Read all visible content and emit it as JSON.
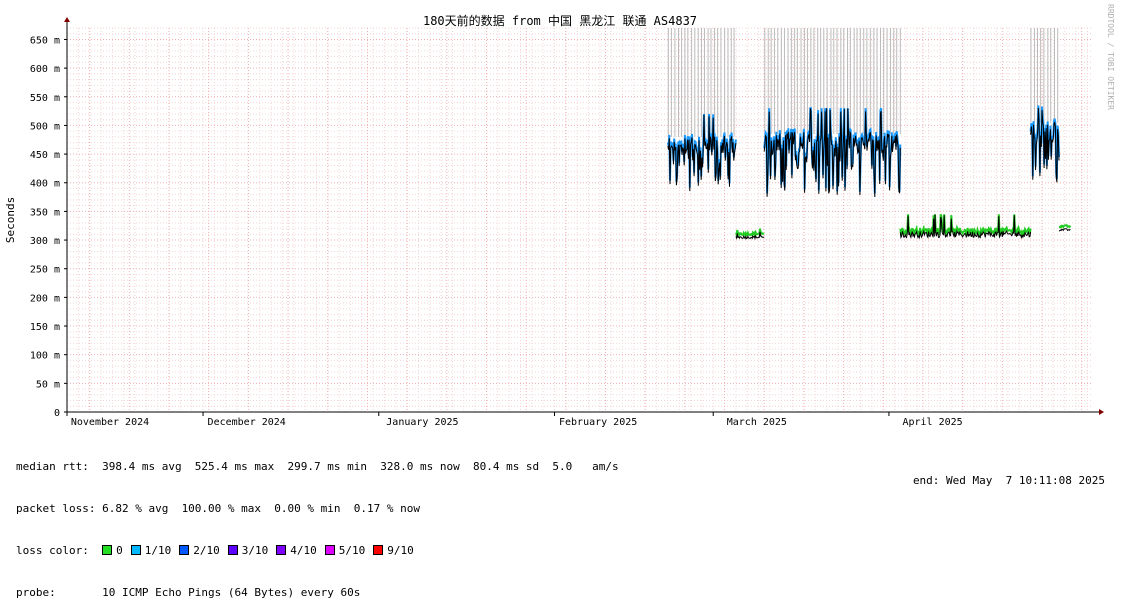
{
  "chart_data": {
    "type": "line",
    "title": "180天前的数据 from 中国 黑龙江 联通 AS4837",
    "ylabel": "Seconds",
    "xlabel": "",
    "ylim": [
      0,
      670
    ],
    "xlim": [
      "2024-11-07",
      "2025-05-07"
    ],
    "y_ticks": [
      {
        "value": 0,
        "label": "0"
      },
      {
        "value": 50,
        "label": "50 m"
      },
      {
        "value": 100,
        "label": "100 m"
      },
      {
        "value": 150,
        "label": "150 m"
      },
      {
        "value": 200,
        "label": "200 m"
      },
      {
        "value": 250,
        "label": "250 m"
      },
      {
        "value": 300,
        "label": "300 m"
      },
      {
        "value": 350,
        "label": "350 m"
      },
      {
        "value": 400,
        "label": "400 m"
      },
      {
        "value": 450,
        "label": "450 m"
      },
      {
        "value": 500,
        "label": "500 m"
      },
      {
        "value": 550,
        "label": "550 m"
      },
      {
        "value": 600,
        "label": "600 m"
      },
      {
        "value": 650,
        "label": "650 m"
      }
    ],
    "x_ticks": [
      {
        "date": "2024-11-01",
        "label": "November 2024"
      },
      {
        "date": "2024-12-01",
        "label": "December 2024"
      },
      {
        "date": "2025-01-01",
        "label": "January 2025"
      },
      {
        "date": "2025-02-01",
        "label": "February 2025"
      },
      {
        "date": "2025-03-01",
        "label": "March 2025"
      },
      {
        "date": "2025-04-01",
        "label": "April 2025"
      }
    ],
    "grid": true,
    "segments": [
      {
        "start": "2025-02-21",
        "end": "2025-03-05",
        "base": 465,
        "low": 385,
        "high": 520,
        "loss_spikes": true
      },
      {
        "start": "2025-03-05",
        "end": "2025-03-10",
        "base": 305,
        "low": 300,
        "high": 320,
        "loss_spikes": false
      },
      {
        "start": "2025-03-10",
        "end": "2025-04-03",
        "base": 470,
        "low": 375,
        "high": 530,
        "loss_spikes": true
      },
      {
        "start": "2025-04-03",
        "end": "2025-04-26",
        "base": 310,
        "low": 300,
        "high": 345,
        "loss_spikes": false
      },
      {
        "start": "2025-04-26",
        "end": "2025-05-01",
        "base": 490,
        "low": 400,
        "high": 535,
        "loss_spikes": true
      },
      {
        "start": "2025-05-01",
        "end": "2025-05-03",
        "base": 318,
        "low": 315,
        "high": 330,
        "loss_spikes": false
      }
    ],
    "colors": {
      "grid": "#f0b0b0",
      "axis": "#000000",
      "arrow": "#800000",
      "median": "#000000",
      "rtt_band": "#1a99ff",
      "loss_spike": "#bbbbbb",
      "low_loss_band": "#22cc22"
    }
  },
  "stats": {
    "median_rtt": "median rtt:  398.4 ms avg  525.4 ms max  299.7 ms min  328.0 ms now  80.4 ms sd  5.0   am/s",
    "packet_loss": "packet loss: 6.82 % avg  100.00 % max  0.00 % min  0.17 % now",
    "loss_color_label": "loss color:",
    "probe": "probe:       10 ICMP Echo Pings (64 Bytes) every 60s",
    "end": "end: Wed May  7 10:11:08 2025"
  },
  "loss_colors": [
    {
      "label": "0",
      "color": "#22dd22"
    },
    {
      "label": "1/10",
      "color": "#00b8ff"
    },
    {
      "label": "2/10",
      "color": "#0059ff"
    },
    {
      "label": "3/10",
      "color": "#5e00ff"
    },
    {
      "label": "4/10",
      "color": "#7e00ff"
    },
    {
      "label": "5/10",
      "color": "#dd00ff"
    },
    {
      "label": "9/10",
      "color": "#ff0000"
    }
  ],
  "watermark": "RRDTOOL / TOBI OETIKER"
}
